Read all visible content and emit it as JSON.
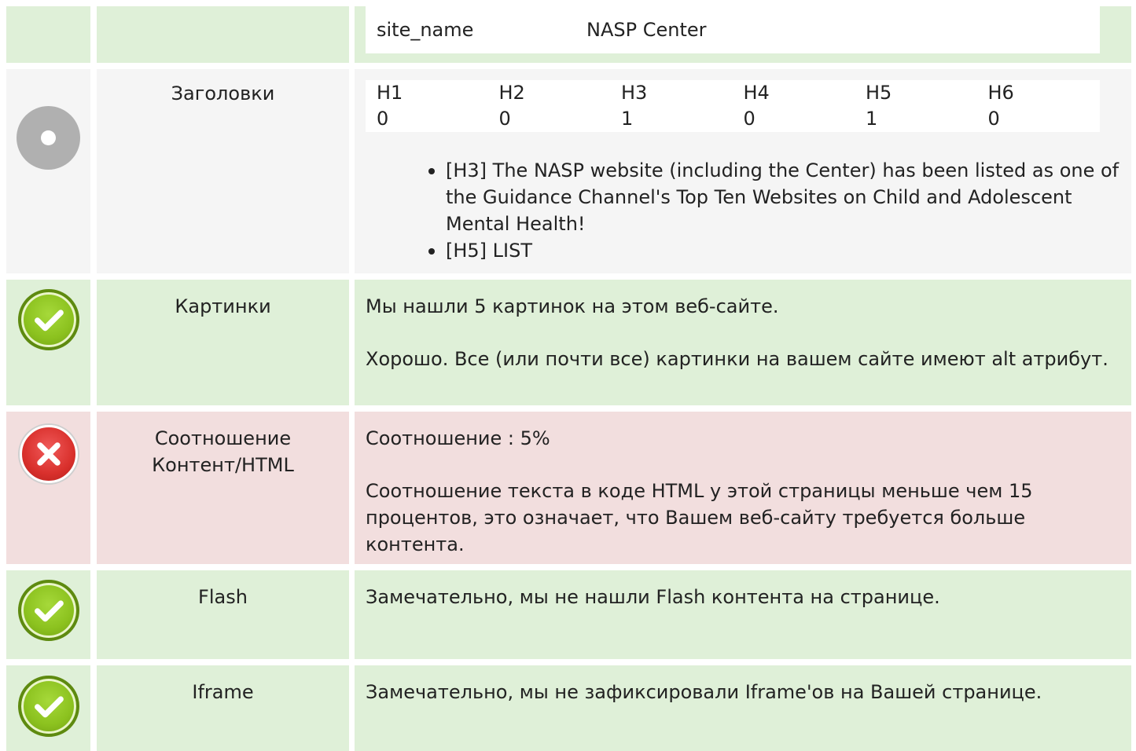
{
  "site_row": {
    "key": "site_name",
    "value": "NASP Center"
  },
  "headings": {
    "label": "Заголовки",
    "columns": [
      "H1",
      "H2",
      "H3",
      "H4",
      "H5",
      "H6"
    ],
    "counts": [
      "0",
      "0",
      "1",
      "0",
      "1",
      "0"
    ],
    "items": [
      "[H3] The NASP website (including the Center) has been listed as one of the Guidance Channel's Top Ten Websites on Child and Adolescent Mental Health!",
      "[H5] LIST"
    ],
    "status": "neutral"
  },
  "images": {
    "label": "Картинки",
    "text1": "Мы нашли 5 картинок на этом веб-сайте.",
    "text2": "Хорошо. Все (или почти все) картинки на вашем сайте имеют alt атрибут.",
    "status": "ok"
  },
  "ratio": {
    "label": "Соотношение Контент/HTML",
    "text1": "Соотношение : 5%",
    "text2": "Соотношение текста в коде HTML у этой страницы меньше чем 15 процентов, это означает, что Вашем веб-сайту требуется больше контента.",
    "status": "error"
  },
  "flash": {
    "label": "Flash",
    "text1": "Замечательно, мы не нашли Flash контента на странице.",
    "status": "ok"
  },
  "iframe": {
    "label": "Iframe",
    "text1": "Замечательно, мы не зафиксировали Iframe'ов на Вашей странице.",
    "status": "ok"
  },
  "colors": {
    "green_bg": "#dff0d8",
    "grey_bg": "#f5f5f5",
    "red_bg": "#f2dede",
    "ok_icon": "#8cc21f",
    "error_icon": "#d9302c",
    "neutral_icon": "#b0b0b0"
  },
  "icons": {
    "ok": "check-circle-icon",
    "error": "x-circle-icon",
    "neutral": "dot-circle-icon"
  }
}
